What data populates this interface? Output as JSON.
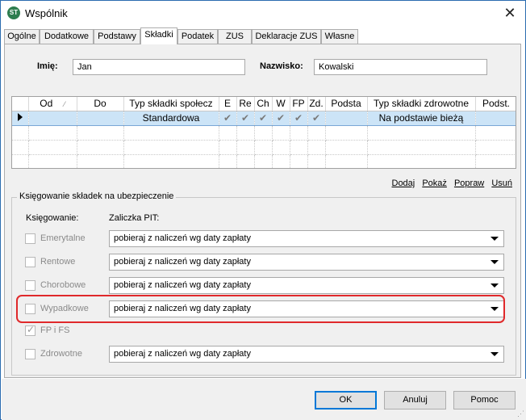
{
  "window": {
    "title": "Wspólnik",
    "icon": "app-logo-icon",
    "close": "✕"
  },
  "tabs": [
    {
      "label": "Ogólne",
      "active": false
    },
    {
      "label": "Dodatkowe",
      "active": false
    },
    {
      "label": "Podstawy",
      "active": false
    },
    {
      "label": "Składki",
      "active": true
    },
    {
      "label": "Podatek",
      "active": false
    },
    {
      "label": "ZUS",
      "active": false
    },
    {
      "label": "Deklaracje ZUS",
      "active": false
    },
    {
      "label": "Własne",
      "active": false
    }
  ],
  "person": {
    "first_name_label": "Imię:",
    "first_name_value": "Jan",
    "last_name_label": "Nazwisko:",
    "last_name_value": "Kowalski"
  },
  "grid": {
    "columns": [
      "",
      "Od",
      "Do",
      "Typ składki społecz",
      "E",
      "Re",
      "Ch",
      "W",
      "FP",
      "Zd.",
      "Podsta",
      "Typ składki zdrowotne",
      "Podst."
    ],
    "rows": [
      [
        "▶",
        "",
        "",
        "Standardowa",
        "✔",
        "✔",
        "✔",
        "✔",
        "✔",
        "✔",
        "",
        "Na podstawie bieżą",
        ""
      ]
    ]
  },
  "actions": {
    "add": "Dodaj",
    "show": "Pokaż",
    "edit": "Popraw",
    "delete": "Usuń"
  },
  "booking": {
    "group_title": "Księgowanie składek na ubezpieczenie",
    "col_booking": "Księgowanie:",
    "col_pit": "Zaliczka PIT:",
    "items": [
      {
        "label": "Emerytalne",
        "checked": false,
        "select": "pobieraj z naliczeń wg daty zapłaty"
      },
      {
        "label": "Rentowe",
        "checked": false,
        "select": "pobieraj z naliczeń wg daty zapłaty"
      },
      {
        "label": "Chorobowe",
        "checked": false,
        "select": "pobieraj z naliczeń wg daty zapłaty"
      },
      {
        "label": "Wypadkowe",
        "checked": false,
        "select": "pobieraj z naliczeń wg daty zapłaty"
      },
      {
        "label": "FP i FS",
        "checked": true,
        "select": ""
      },
      {
        "label": "Zdrowotne",
        "checked": false,
        "select": "pobieraj z naliczeń wg daty zapłaty"
      }
    ]
  },
  "buttons": {
    "ok": "OK",
    "cancel": "Anuluj",
    "help": "Pomoc"
  },
  "colors": {
    "accent": "#0078d7",
    "highlight": "#e0292b",
    "selected_row": "#cce4f7"
  }
}
